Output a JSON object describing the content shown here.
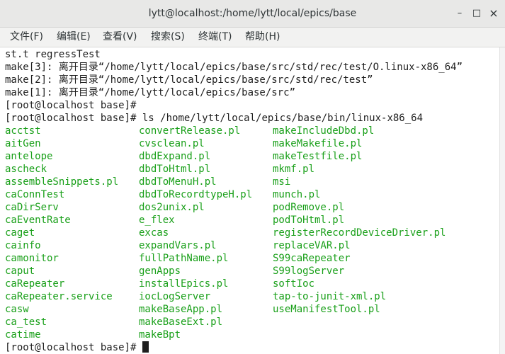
{
  "window": {
    "title": "lytt@localhost:/home/lytt/local/epics/base",
    "minimize": "–",
    "maximize": "□",
    "close": "×"
  },
  "menu": [
    "文件(F)",
    "编辑(E)",
    "查看(V)",
    "搜索(S)",
    "终端(T)",
    "帮助(H)"
  ],
  "terminal": {
    "pre_lines": [
      "st.t regressTest",
      "make[3]: 离开目录“/home/lytt/local/epics/base/src/std/rec/test/O.linux-x86_64”",
      "make[2]: 离开目录“/home/lytt/local/epics/base/src/std/rec/test”",
      "make[1]: 离开目录“/home/lytt/local/epics/base/src”",
      "[root@localhost base]#"
    ],
    "prompt": "[root@localhost base]# ",
    "command": "ls /home/lytt/local/epics/base/bin/linux-x86_64",
    "columns": [
      [
        "acctst",
        "aitGen",
        "antelope",
        "ascheck",
        "assembleSnippets.pl",
        "caConnTest",
        "caDirServ",
        "caEventRate",
        "caget",
        "cainfo",
        "camonitor",
        "caput",
        "caRepeater",
        "caRepeater.service",
        "casw",
        "ca_test",
        "catime"
      ],
      [
        "convertRelease.pl",
        "cvsclean.pl",
        "dbdExpand.pl",
        "dbdToHtml.pl",
        "dbdToMenuH.pl",
        "dbdToRecordtypeH.pl",
        "dos2unix.pl",
        "e_flex",
        "excas",
        "expandVars.pl",
        "fullPathName.pl",
        "genApps",
        "installEpics.pl",
        "iocLogServer",
        "makeBaseApp.pl",
        "makeBaseExt.pl",
        "makeBpt"
      ],
      [
        "makeIncludeDbd.pl",
        "makeMakefile.pl",
        "makeTestfile.pl",
        "mkmf.pl",
        "msi",
        "munch.pl",
        "podRemove.pl",
        "podToHtml.pl",
        "registerRecordDeviceDriver.pl",
        "replaceVAR.pl",
        "S99caRepeater",
        "S99logServer",
        "softIoc",
        "tap-to-junit-xml.pl",
        "useManifestTool.pl"
      ]
    ],
    "final_prompt": "[root@localhost base]# "
  },
  "colors": {
    "file_green": "#1aa01a",
    "text": "#1e1e1e",
    "titlebar": "#e8e8e7"
  }
}
